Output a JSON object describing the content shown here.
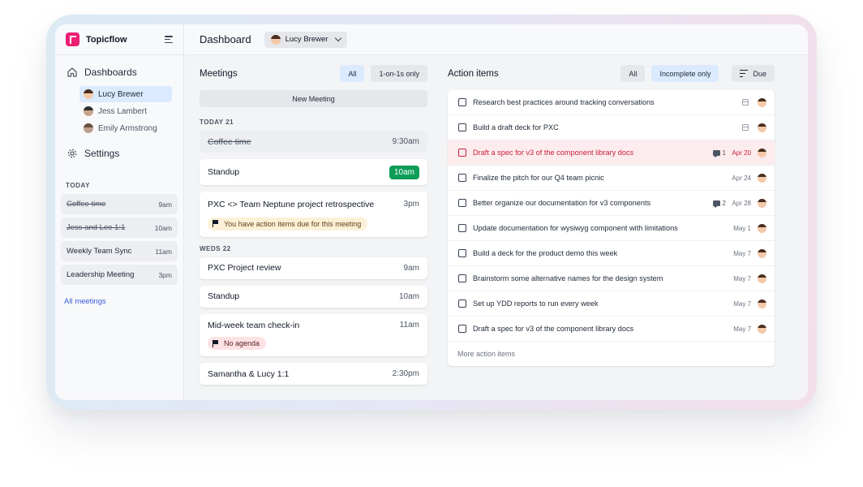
{
  "app": {
    "name": "Topicflow"
  },
  "sidebar": {
    "dashboards_label": "Dashboards",
    "users": [
      {
        "name": "Lucy Brewer",
        "active": true
      },
      {
        "name": "Jess Lambert",
        "active": false
      },
      {
        "name": "Emily Armstrong",
        "active": false
      }
    ],
    "settings_label": "Settings",
    "today_label": "TODAY",
    "meetings": [
      {
        "name": "Coffee time",
        "time": "9am",
        "done": true
      },
      {
        "name": "Jess and Lee 1:1",
        "time": "10am",
        "done": true
      },
      {
        "name": "Weekly Team Sync",
        "time": "11am",
        "done": false
      },
      {
        "name": "Leadership Meeting",
        "time": "3pm",
        "done": false
      }
    ],
    "all_meetings_label": "All meetings"
  },
  "header": {
    "title": "Dashboard",
    "selected_user": "Lucy Brewer"
  },
  "meetings": {
    "title": "Meetings",
    "filter_all": "All",
    "filter_1on1": "1-on-1s only",
    "new_meeting": "New Meeting",
    "day1": "TODAY 21",
    "day2": "WEDS 22",
    "m1": {
      "name": "Coffee time",
      "time": "9:30am"
    },
    "m2": {
      "name": "Standup",
      "time": "10am"
    },
    "m3": {
      "name": "PXC <> Team Neptune project retrospective",
      "time": "3pm",
      "note": "You have action items due for this meeting"
    },
    "m4": {
      "name": "PXC Project review",
      "time": "9am"
    },
    "m5": {
      "name": "Standup",
      "time": "10am"
    },
    "m6": {
      "name": "Mid-week team check-in",
      "time": "11am",
      "note": "No agenda"
    },
    "m7": {
      "name": "Samantha & Lucy 1:1",
      "time": "2:30pm"
    }
  },
  "actions": {
    "title": "Action items",
    "filter_all": "All",
    "filter_incomplete": "Incomplete only",
    "sort_label": "Due",
    "items": [
      {
        "text": "Research best practices around tracking conversations",
        "due": "",
        "comments": ""
      },
      {
        "text": "Build a draft deck for PXC",
        "due": "",
        "comments": ""
      },
      {
        "text": "Draft a spec for v3 of the component library docs",
        "due": "Apr 20",
        "comments": "1",
        "overdue": true
      },
      {
        "text": "Finalize the pitch for our Q4 team picnic",
        "due": "Apr 24",
        "comments": ""
      },
      {
        "text": "Better organize our documentation for v3 components",
        "due": "Apr 28",
        "comments": "2"
      },
      {
        "text": "Update documentation for wysiwyg component with limitations",
        "due": "May 1",
        "comments": ""
      },
      {
        "text": "Build a deck for the product demo this week",
        "due": "May 7",
        "comments": ""
      },
      {
        "text": "Brainstorm some alternative names for the design system",
        "due": "May 7",
        "comments": ""
      },
      {
        "text": "Set up YDD reports to run every week",
        "due": "May 7",
        "comments": ""
      },
      {
        "text": "Draft a spec for v3 of the component library docs",
        "due": "May 7",
        "comments": ""
      }
    ],
    "more_label": "More action items"
  }
}
